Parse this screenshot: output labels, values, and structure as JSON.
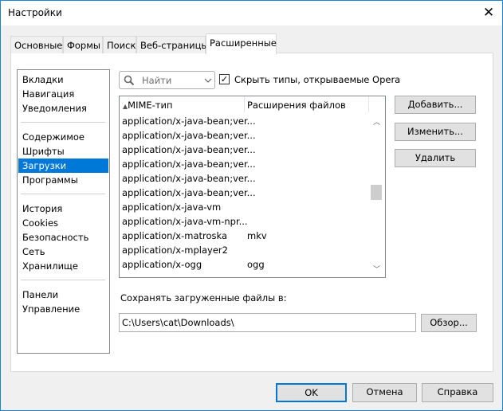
{
  "window": {
    "title": "Настройки",
    "close_icon": "close-icon"
  },
  "tabs": [
    "Основные",
    "Формы",
    "Поиск",
    "Веб-страницы",
    "Расширенные"
  ],
  "active_tab": "Расширенные",
  "sidebar": {
    "items": [
      "Вкладки",
      "Навигация",
      "Уведомления",
      "Содержимое",
      "Шрифты",
      "Загрузки",
      "Программы",
      "История",
      "Cookies",
      "Безопасность",
      "Сеть",
      "Хранилище",
      "Панели",
      "Управление"
    ],
    "selected": "Загрузки"
  },
  "search": {
    "placeholder": "Найти",
    "icon": "search-icon"
  },
  "hide_types": {
    "label": "Скрыть типы, открываемые Opera",
    "checked": true
  },
  "mime_table": {
    "columns": [
      "MIME-тип",
      "Расширения файлов"
    ],
    "sort": "ascending",
    "rows": [
      [
        "application/x-java-bean;ver...",
        ""
      ],
      [
        "application/x-java-bean;ver...",
        ""
      ],
      [
        "application/x-java-bean;ver...",
        ""
      ],
      [
        "application/x-java-bean;ver...",
        ""
      ],
      [
        "application/x-java-bean;ver...",
        ""
      ],
      [
        "application/x-java-bean;ver...",
        ""
      ],
      [
        "application/x-java-vm",
        ""
      ],
      [
        "application/x-java-vm-npr...",
        ""
      ],
      [
        "application/x-matroska",
        "mkv"
      ],
      [
        "application/x-mplayer2",
        ""
      ],
      [
        "application/x-ogg",
        "ogg"
      ],
      [
        "",
        ""
      ]
    ]
  },
  "buttons": {
    "add": "Добавить...",
    "edit": "Изменить...",
    "delete": "Удалить",
    "browse": "Обзор...",
    "ok": "OK",
    "cancel": "Отмена",
    "help": "Справка"
  },
  "download": {
    "label": "Сохранять загруженные файлы в:",
    "path": "C:\\Users\\cat\\Downloads\\"
  },
  "colors": {
    "accent": "#0078d7",
    "window_border": "#1883d7"
  }
}
